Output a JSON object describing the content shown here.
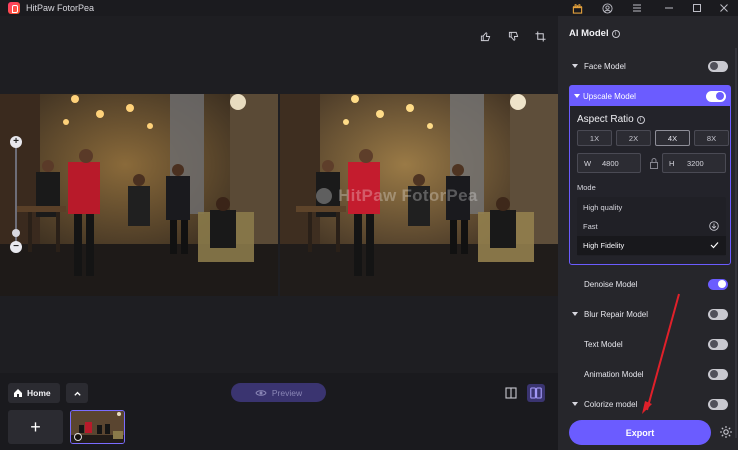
{
  "window": {
    "title": "HitPaw FotorPea",
    "controls": [
      "gift-icon",
      "user-icon",
      "menu-icon",
      "minimize-icon",
      "maximize-icon",
      "close-icon"
    ]
  },
  "canvas": {
    "watermark": "HitPaw FotorPea"
  },
  "bottom": {
    "home_label": "Home",
    "add_label": "+",
    "preview_label": "Preview"
  },
  "panel": {
    "title": "AI Model",
    "models": {
      "face": "Face Model",
      "upscale": "Upscale Model",
      "denoise": "Denoise Model",
      "blur": "Blur Repair Model",
      "text": "Text Model",
      "animation": "Animation Model",
      "colorize": "Colorize model"
    },
    "toggles": {
      "face": false,
      "upscale": true,
      "denoise": true,
      "blur": false,
      "text": false,
      "animation": false,
      "colorize": false
    },
    "aspect": {
      "title": "Aspect Ratio",
      "scales": [
        "1X",
        "2X",
        "4X",
        "8X"
      ],
      "selected": "4X",
      "w_label": "W",
      "w_value": "4800",
      "h_label": "H",
      "h_value": "3200"
    },
    "mode": {
      "title": "Mode",
      "options": [
        "High quality",
        "Fast",
        "High Fidelity"
      ],
      "selected": "High Fidelity"
    },
    "export_label": "Export"
  },
  "colors": {
    "accent": "#6b5cff",
    "panel_bg": "#26262b",
    "canvas_bg": "#1e1e22",
    "annotation_arrow": "#e0202a"
  }
}
